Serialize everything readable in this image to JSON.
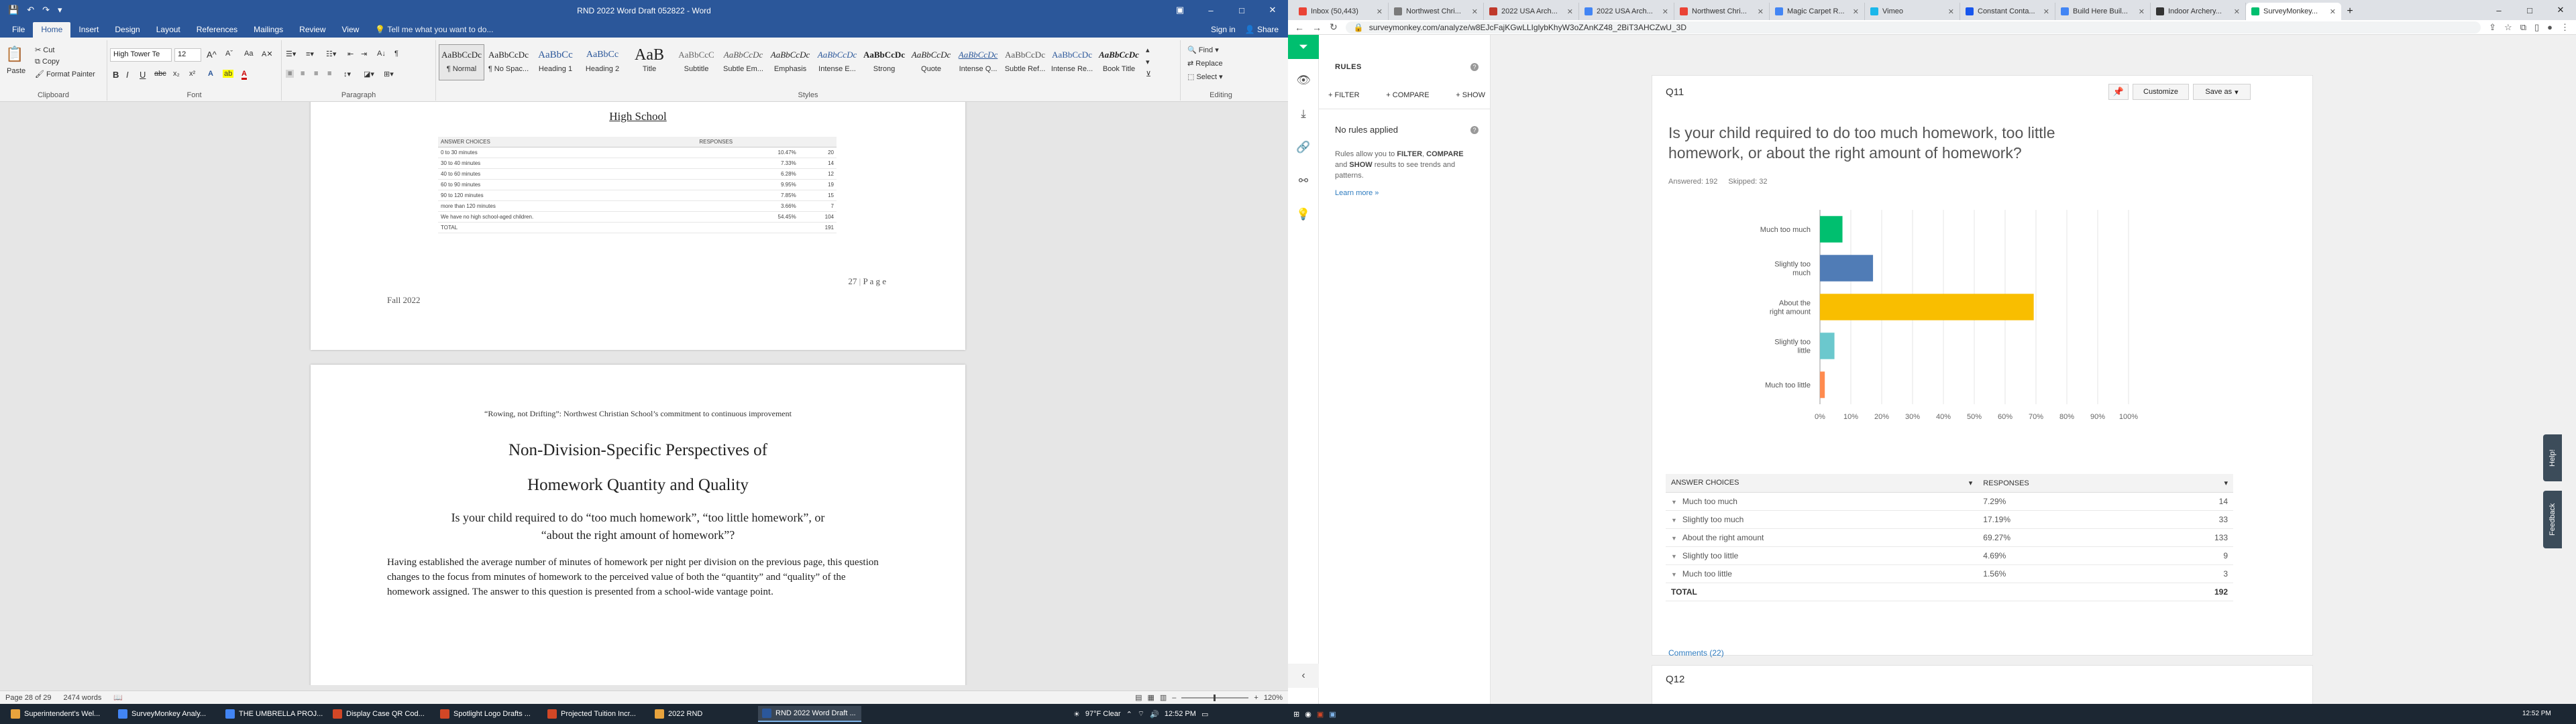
{
  "word": {
    "qat_icons": [
      "save-icon",
      "undo-icon",
      "redo-icon"
    ],
    "title": "RND 2022 Word Draft 052822 - Word",
    "win": {
      "restore": "▣",
      "min": "–",
      "max": "□",
      "close": "✕"
    },
    "tabs": [
      "File",
      "Home",
      "Insert",
      "Design",
      "Layout",
      "References",
      "Mailings",
      "Review",
      "View"
    ],
    "tell_me": "Tell me what you want to do...",
    "sign_in": "Sign in",
    "share": "Share",
    "clipboard": {
      "paste": "Paste",
      "cut": "Cut",
      "copy": "Copy",
      "format_painter": "Format Painter",
      "label": "Clipboard"
    },
    "font": {
      "name": "High Tower Te",
      "size": "12",
      "label": "Font",
      "bold": "B",
      "italic": "I",
      "underline": "U",
      "strike": "abc",
      "sub": "x₂",
      "sup": "x²"
    },
    "paragraph": {
      "label": "Paragraph"
    },
    "styles": {
      "label": "Styles",
      "items": [
        {
          "preview": "AaBbCcDc",
          "name": "¶ Normal"
        },
        {
          "preview": "AaBbCcDc",
          "name": "¶ No Spac..."
        },
        {
          "preview": "AaBbCc",
          "name": "Heading 1"
        },
        {
          "preview": "AaBbCc",
          "name": "Heading 2"
        },
        {
          "preview": "AaB",
          "name": "Title"
        },
        {
          "preview": "AaBbCcC",
          "name": "Subtitle"
        },
        {
          "preview": "AaBbCcDc",
          "name": "Subtle Em..."
        },
        {
          "preview": "AaBbCcDc",
          "name": "Emphasis"
        },
        {
          "preview": "AaBbCcDc",
          "name": "Intense E..."
        },
        {
          "preview": "AaBbCcDc",
          "name": "Strong"
        },
        {
          "preview": "AaBbCcDc",
          "name": "Quote"
        },
        {
          "preview": "AaBbCcDc",
          "name": "Intense Q..."
        },
        {
          "preview": "AaBbCcDc",
          "name": "Subtle Ref..."
        },
        {
          "preview": "AaBbCcDc",
          "name": "Intense Re..."
        },
        {
          "preview": "AaBbCcDc",
          "name": "Book Title"
        }
      ]
    },
    "editing": {
      "find": "Find",
      "replace": "Replace",
      "select": "Select",
      "label": "Editing"
    },
    "page1": {
      "heading": "High School",
      "table": {
        "headers": [
          "ANSWER CHOICES",
          "RESPONSES",
          ""
        ],
        "rows": [
          [
            "0 to 30 minutes",
            "10.47%",
            "20"
          ],
          [
            "30 to 40 minutes",
            "7.33%",
            "14"
          ],
          [
            "40 to 60 minutes",
            "6.28%",
            "12"
          ],
          [
            "60 to 90 minutes",
            "9.95%",
            "19"
          ],
          [
            "90 to 120 minutes",
            "7.85%",
            "15"
          ],
          [
            "more than 120 minutes",
            "3.66%",
            "7"
          ],
          [
            "We have no high school-aged children.",
            "54.45%",
            "104"
          ]
        ],
        "total": [
          "TOTAL",
          "",
          "191"
        ]
      },
      "page_number": "27",
      "page_sep": "|",
      "page_word": "P a g e",
      "footer": "Fall 2022"
    },
    "page2": {
      "header": "“Rowing, not Drifting”:  Northwest Christian School’s commitment to continuous improvement",
      "h1": "Non-Division-Specific Perspectives of",
      "h2": "Homework Quantity and Quality",
      "q1": "Is your child required to do “too much homework”, “too little homework”, or",
      "q2": "“about the right amount of homework”?",
      "body": "Having established the average number of minutes of homework per night per division on the previous page, this question changes to the focus from minutes of homework to the perceived value of both the “quantity” and “quality” of the homework assigned.  The answer to this question is presented from a school-wide vantage point."
    },
    "status": {
      "page": "Page 28 of 29",
      "words": "2474 words",
      "zoom": "120%",
      "zoom_minus": "–",
      "zoom_plus": "+"
    }
  },
  "browser": {
    "tabs": [
      {
        "title": "Inbox (50,443)",
        "color": "#ea4335"
      },
      {
        "title": "Northwest Chri...",
        "color": "#7a7a7a"
      },
      {
        "title": "2022 USA Arch...",
        "color": "#c0392b"
      },
      {
        "title": "2022 USA Arch...",
        "color": "#4285f4"
      },
      {
        "title": "Northwest Chri...",
        "color": "#ea4335"
      },
      {
        "title": "Magic Carpet R...",
        "color": "#4285f4"
      },
      {
        "title": "Vimeo",
        "color": "#1ab7ea"
      },
      {
        "title": "Constant Conta...",
        "color": "#1856ed"
      },
      {
        "title": "Build Here Buil...",
        "color": "#4285f4"
      },
      {
        "title": "Indoor Archery...",
        "color": "#333333"
      },
      {
        "title": "SurveyMonkey...",
        "color": "#00bf6f"
      }
    ],
    "new_tab": "+",
    "url": "surveymonkey.com/analyze/w8EJcFajKGwLLIglybKhyW3oZAnKZ48_2BiT3AHCZwU_3D",
    "win": {
      "min": "–",
      "max": "□",
      "close": "✕"
    },
    "rules": {
      "title": "RULES",
      "filter": "+ FILTER",
      "compare": "+ COMPARE",
      "show": "+ SHOW",
      "no_rules": "No rules applied",
      "desc_pre": "Rules allow you to ",
      "desc_filter": "FILTER",
      "desc_sep1": ", ",
      "desc_compare": "COMPARE",
      "desc_and": " and ",
      "desc_show": "SHOW",
      "desc_post": " results to see trends and patterns.",
      "learn": "Learn more »"
    },
    "question": {
      "number": "Q11",
      "customize": "Customize",
      "save_as": "Save as",
      "text": "Is your child required to do too much homework, too little homework, or about the right amount of homework?",
      "answered": "Answered: 192",
      "skipped": "Skipped: 32",
      "table_headers": [
        "ANSWER CHOICES",
        "RESPONSES",
        ""
      ],
      "rows": [
        [
          "Much too much",
          "7.29%",
          "14"
        ],
        [
          "Slightly too much",
          "17.19%",
          "33"
        ],
        [
          "About the right amount",
          "69.27%",
          "133"
        ],
        [
          "Slightly too little",
          "4.69%",
          "9"
        ],
        [
          "Much too little",
          "1.56%",
          "3"
        ]
      ],
      "total": [
        "TOTAL",
        "",
        "192"
      ],
      "comments": "Comments (22)"
    },
    "q12": "Q12",
    "help": "Help!",
    "feedback": "Feedback"
  },
  "chart_data": {
    "type": "bar",
    "orientation": "horizontal",
    "categories": [
      "Much too much",
      "Slightly too much",
      "About the right amount",
      "Slightly too little",
      "Much too little"
    ],
    "category_labels": [
      [
        "Much too much"
      ],
      [
        "Slightly too",
        "much"
      ],
      [
        "About the",
        "right amount"
      ],
      [
        "Slightly too",
        "little"
      ],
      [
        "Much too little"
      ]
    ],
    "values": [
      7.29,
      17.19,
      69.27,
      4.69,
      1.56
    ],
    "colors": [
      "#00bf6f",
      "#507cb6",
      "#f9be00",
      "#6bc8cd",
      "#ff8b4f"
    ],
    "xlim": [
      0,
      100
    ],
    "ticks": [
      "0%",
      "10%",
      "20%",
      "30%",
      "40%",
      "50%",
      "60%",
      "70%",
      "80%",
      "90%",
      "100%"
    ],
    "grid": true
  },
  "taskbar": {
    "apps": [
      {
        "title": "Superintendent's Wel...",
        "color": "#e8a33d"
      },
      {
        "title": "SurveyMonkey Analy...",
        "color": "#4285f4"
      },
      {
        "title": "THE UMBRELLA PROJ...",
        "color": "#4285f4"
      },
      {
        "title": "Display Case QR Cod...",
        "color": "#d24726"
      },
      {
        "title": "Spotlight Logo Drafts ...",
        "color": "#d24726"
      },
      {
        "title": "Projected Tuition Incr...",
        "color": "#d24726"
      },
      {
        "title": "2022 RND",
        "color": "#e8a33d"
      },
      {
        "title": "RND 2022 Word Draft ...",
        "color": "#2b579a"
      }
    ],
    "weather": "97°F  Clear",
    "time": "12:52 PM",
    "tray_time_right": "12:52 PM"
  }
}
